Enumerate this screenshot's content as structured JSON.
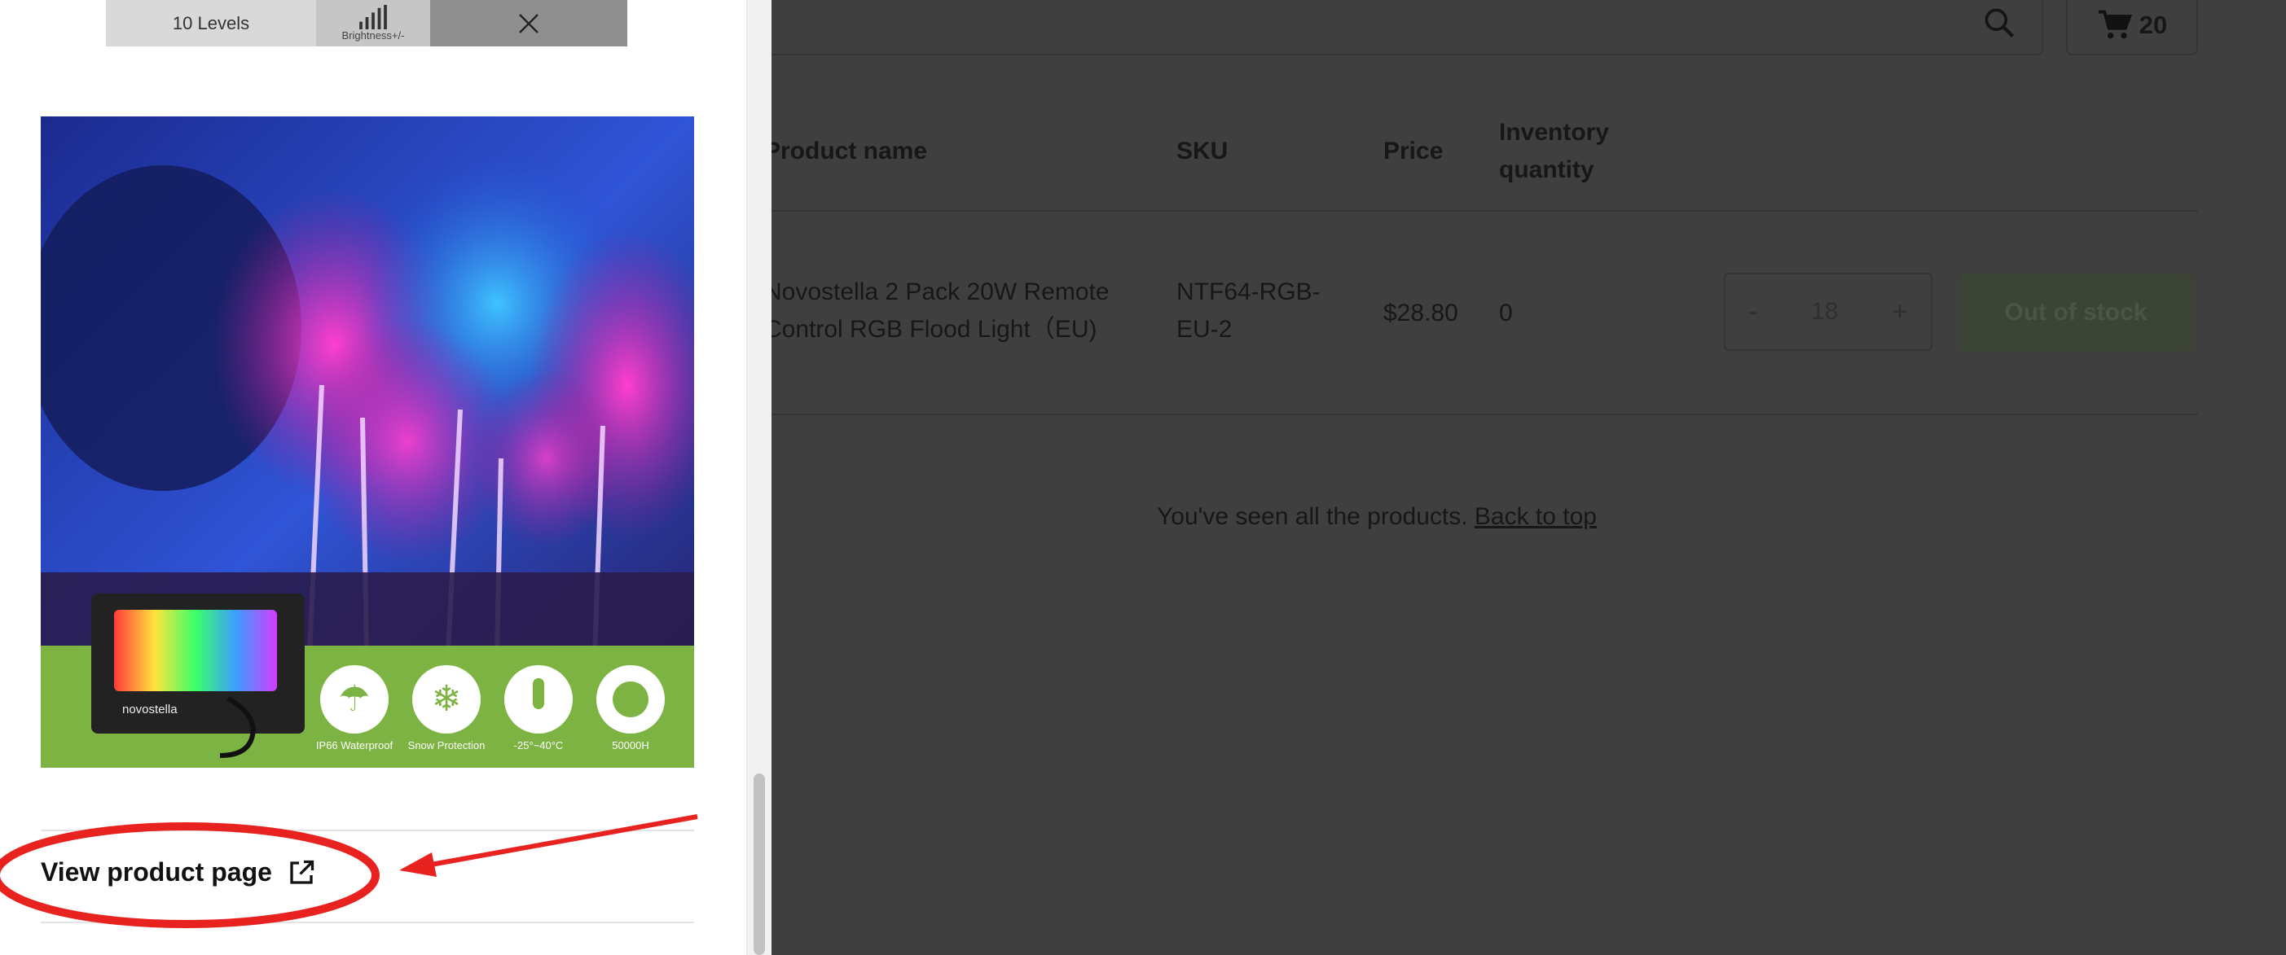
{
  "cart": {
    "count": "20"
  },
  "table": {
    "headers": {
      "name": "Product name",
      "sku": "SKU",
      "price": "Price",
      "inventory": "Inventory quantity"
    },
    "row": {
      "name": "Novostella 2 Pack 20W Remote Control RGB Flood Light（EU)",
      "sku": "NTF64-RGB-EU-2",
      "price": "$28.80",
      "inventory": "0",
      "quantity": "18",
      "minus": "-",
      "plus": "+",
      "status_button": "Out of stock"
    }
  },
  "footer_note": {
    "text": "You've seen all the products.",
    "link": "Back to top"
  },
  "drawer": {
    "strip": {
      "levels": "10 Levels",
      "brightness": "Brightness+/-"
    },
    "image_badges": [
      "IP66 Waterproof",
      "Snow Protection",
      "-25°~40°C",
      "50000H"
    ],
    "product_logo": "novostella",
    "view_product_link": "View product page"
  },
  "colors": {
    "overlay_bg": "#3f3f3f",
    "drawer_bg": "#ffffff",
    "annotation_red": "#e8231f",
    "image_green": "#7cb342",
    "out_of_stock_bg": "#3b4435"
  },
  "icons": [
    "search-icon",
    "cart-icon",
    "close-icon",
    "brightness-bars-icon",
    "external-link-icon"
  ]
}
